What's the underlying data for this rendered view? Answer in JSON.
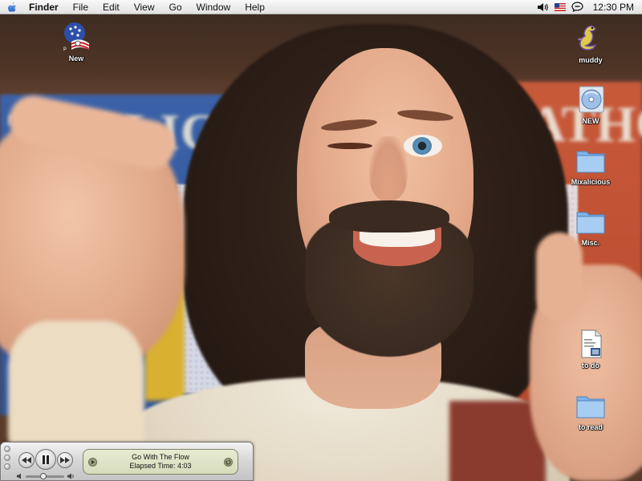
{
  "menubar": {
    "apple_icon": "apple-icon",
    "app_name": "Finder",
    "menus": [
      "File",
      "Edit",
      "View",
      "Go",
      "Window",
      "Help"
    ],
    "status_icons": [
      "volume-icon",
      "us-flag-icon",
      "chat-bubble-icon"
    ],
    "clock": "12:30 PM"
  },
  "desktop_icons": {
    "new_left": {
      "label": "New",
      "icon": "flag-globe-icon"
    },
    "muddy": {
      "label": "muddy",
      "icon": "dragon-icon"
    },
    "new_disc": {
      "label": "NEW",
      "icon": "disc-icon"
    },
    "mixalicious": {
      "label": "Mixalicious",
      "icon": "folder-icon"
    },
    "misc": {
      "label": "Misc.",
      "icon": "folder-icon"
    },
    "to_do": {
      "label": "to do",
      "icon": "document-icon"
    },
    "to_read": {
      "label": "to read",
      "icon": "folder-icon"
    }
  },
  "wallpaper": {
    "sign_left_text": "THOLICISM",
    "sign_right_text": "CATHO"
  },
  "mini_player": {
    "track_title": "Go With The Flow",
    "elapsed_label": "Elapsed Time: 4:03",
    "volume_level": 0.45,
    "state": "playing"
  },
  "colors": {
    "menubar_bg": "#ececec",
    "folder_blue": "#7fb3e8",
    "lcd_bg": "#e2e7cb"
  }
}
